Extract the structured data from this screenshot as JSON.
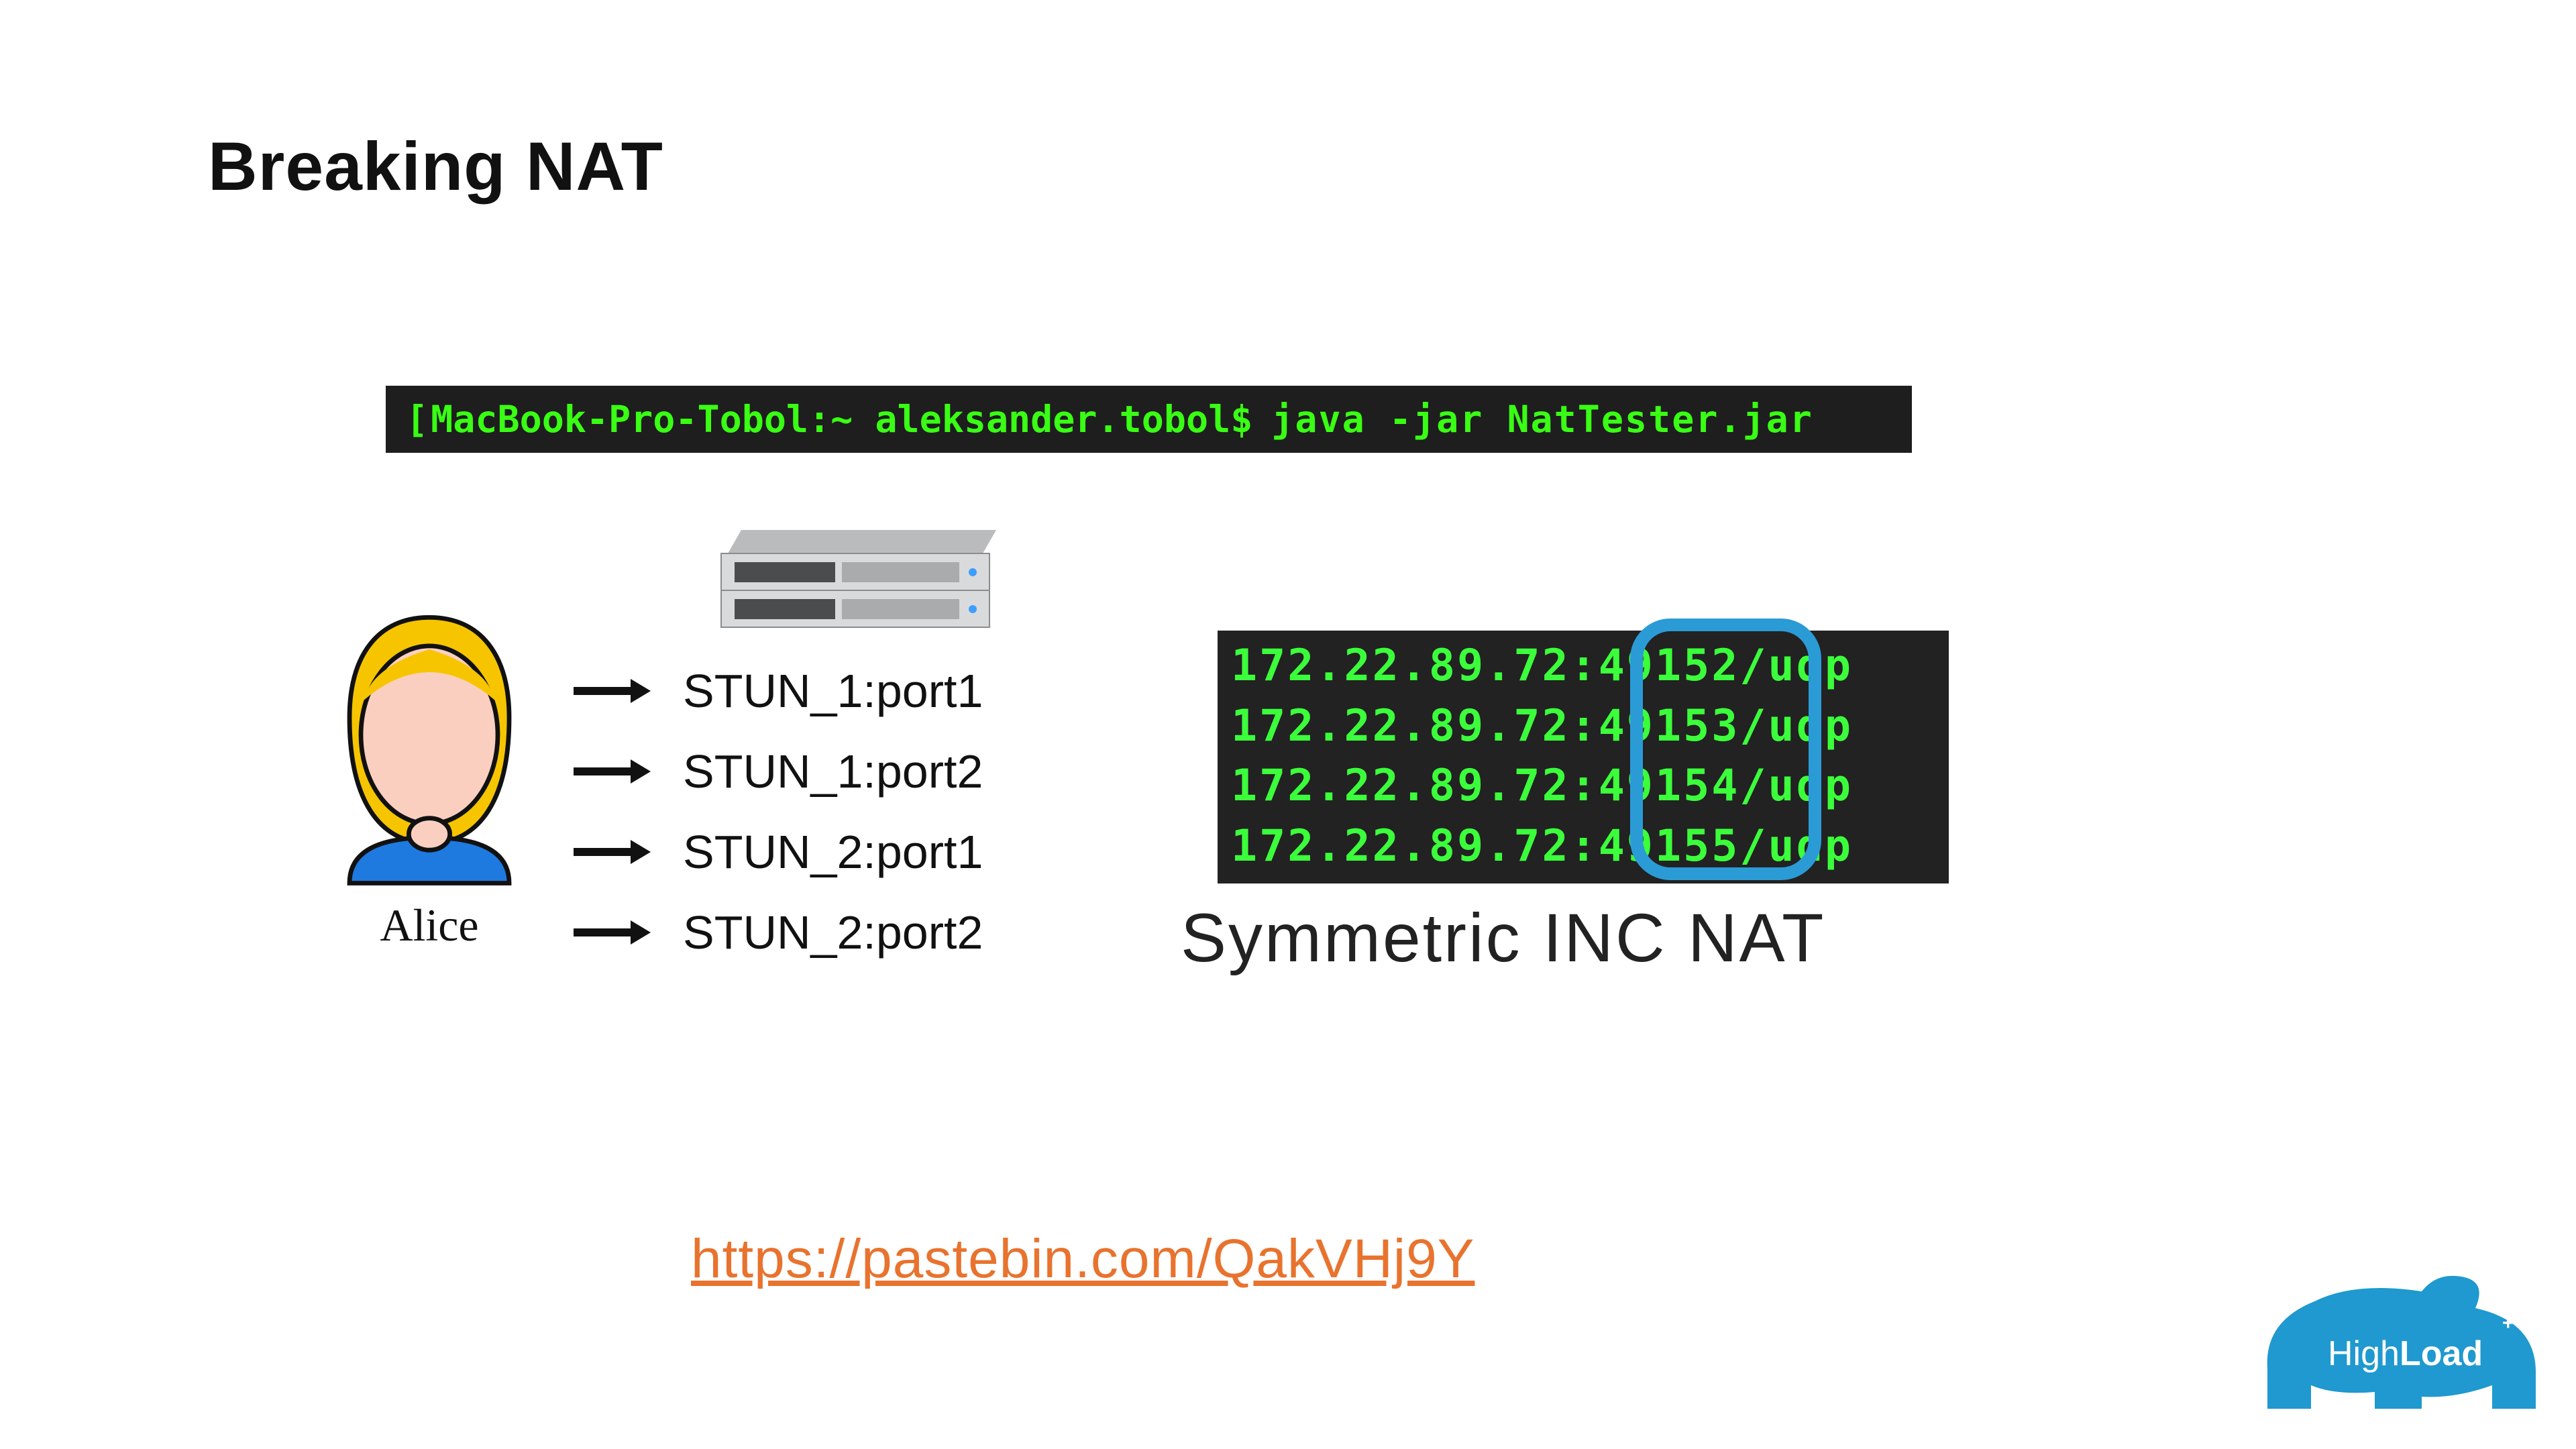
{
  "title": "Breaking NAT",
  "cmd_bracket": "[",
  "cmd_host": "MacBook-Pro-Tobol:~ aleksander.tobol",
  "cmd_prompt": "$",
  "cmd_body": "java -jar NatTester.jar",
  "alice_label": "Alice",
  "stun_items": [
    "STUN_1:port1",
    "STUN_1:port2",
    "STUN_2:port1",
    "STUN_2:port2"
  ],
  "term_lines": [
    {
      "ip": "172.22.89.72",
      "sep": ":",
      "port": "49152",
      "tail": "/udp"
    },
    {
      "ip": "172.22.89.72",
      "sep": ":",
      "port": "49153",
      "tail": "/udp"
    },
    {
      "ip": "172.22.89.72",
      "sep": ":",
      "port": "49154",
      "tail": "/udp"
    },
    {
      "ip": "172.22.89.72",
      "sep": ":",
      "port": "49155",
      "tail": "/udp"
    }
  ],
  "nat_caption": "Symmetric INC NAT",
  "link_text": "https://pastebin.com/QakVHj9Y",
  "logo_thin": "High",
  "logo_bold": "Load",
  "logo_suffix": "++"
}
